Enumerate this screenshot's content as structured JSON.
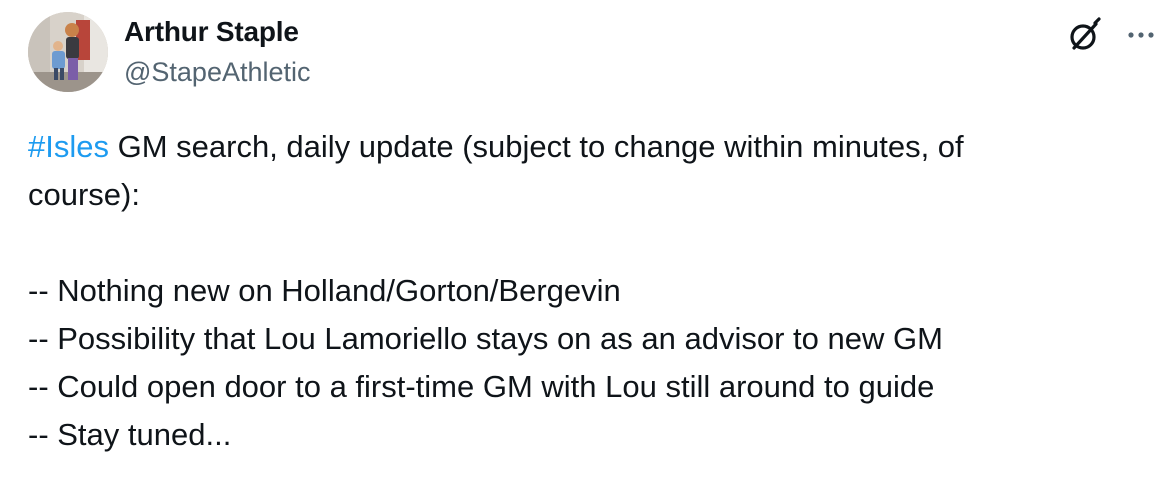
{
  "author": {
    "display_name": "Arthur Staple",
    "handle": "@StapeAthletic"
  },
  "header_icons": {
    "grok": "grok-icon",
    "more": "more-dots-icon"
  },
  "tweet": {
    "hashtag": "#Isles",
    "line1_rest": " GM search, daily update (subject to change within minutes, of",
    "line2": "course):",
    "bullets": [
      "-- Nothing new on Holland/Gorton/Bergevin",
      "-- Possibility that Lou Lamoriello stays on as an advisor to new GM",
      "-- Could open door to a first-time GM with Lou still around to guide",
      "-- Stay tuned..."
    ]
  },
  "colors": {
    "text": "#0f1419",
    "secondary": "#536471",
    "link": "#1d9bf0"
  }
}
